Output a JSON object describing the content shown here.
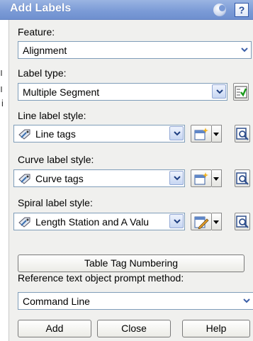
{
  "window": {
    "title": "Add Labels",
    "help_label": "?"
  },
  "edge": {
    "fragment": "i"
  },
  "feature": {
    "label": "Feature:",
    "value": "Alignment"
  },
  "label_type": {
    "label": "Label type:",
    "value": "Multiple Segment"
  },
  "line_style": {
    "label": "Line label style:",
    "value": "Line tags"
  },
  "curve_style": {
    "label": "Curve label style:",
    "value": "Curve tags"
  },
  "spiral_style": {
    "label": "Spiral label style:",
    "value": "Length Station and A Valu"
  },
  "table_tag": {
    "label": "Table Tag Numbering"
  },
  "reference": {
    "label": "Reference text object prompt method:",
    "value": "Command Line"
  },
  "buttons": {
    "add": "Add",
    "close": "Close",
    "help": "Help"
  },
  "colors": {
    "titlebar": "#7a9ad6",
    "panel": "#f0f0ee",
    "field_border": "#7f9db9",
    "accent": "#2b4f9c"
  }
}
